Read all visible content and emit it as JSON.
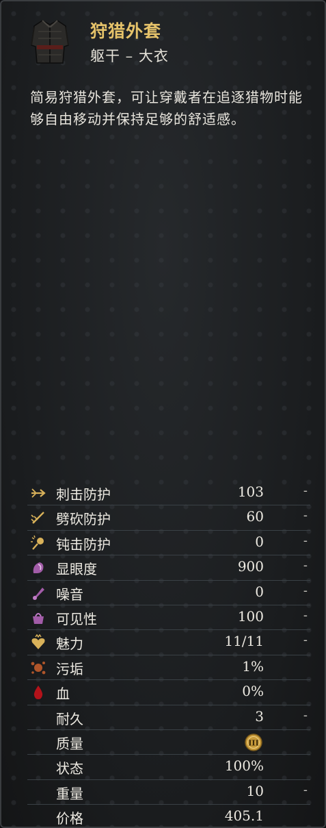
{
  "item": {
    "title": "狩猎外套",
    "subtitle": "躯干 – 大衣",
    "description": "简易狩猎外套，可让穿戴者在追逐猎物时能够自由移动并保持足够的舒适感。",
    "icon": "hunting-coat-icon"
  },
  "stats": [
    {
      "name": "stab-protection",
      "icon": "stab-icon",
      "label": "刺击防护",
      "value": "103",
      "dash": "-"
    },
    {
      "name": "slash-protection",
      "icon": "slash-icon",
      "label": "劈砍防护",
      "value": "60",
      "dash": "-"
    },
    {
      "name": "blunt-protection",
      "icon": "blunt-icon",
      "label": "钝击防护",
      "value": "0",
      "dash": "-"
    },
    {
      "name": "conspicuousness",
      "icon": "conspicuousness-icon",
      "label": "显眼度",
      "value": "900",
      "dash": "-"
    },
    {
      "name": "noise",
      "icon": "noise-icon",
      "label": "噪音",
      "value": "0",
      "dash": "-"
    },
    {
      "name": "visibility",
      "icon": "visibility-icon",
      "label": "可见性",
      "value": "100",
      "dash": "-"
    },
    {
      "name": "charisma",
      "icon": "charisma-icon",
      "label": "魅力",
      "value": "11/11",
      "dash": "-"
    },
    {
      "name": "dirt",
      "icon": "dirt-icon",
      "label": "污垢",
      "value": "1%",
      "dash": ""
    },
    {
      "name": "blood",
      "icon": "blood-icon",
      "label": "血",
      "value": "0%",
      "dash": ""
    },
    {
      "name": "durability",
      "icon": "",
      "label": "耐久",
      "value": "3",
      "dash": "-"
    },
    {
      "name": "quality",
      "icon": "",
      "label": "质量",
      "value": "",
      "dash": "",
      "quality_badge": "III"
    },
    {
      "name": "condition",
      "icon": "",
      "label": "状态",
      "value": "100%",
      "dash": ""
    },
    {
      "name": "weight",
      "icon": "",
      "label": "重量",
      "value": "10",
      "dash": "-"
    },
    {
      "name": "price",
      "icon": "",
      "label": "价格",
      "value": "405.1",
      "dash": ""
    }
  ],
  "colors": {
    "title": "#e6c36a",
    "text": "#eeebe3",
    "icon_gold": "#d9b25a",
    "icon_purple": "#a25ca8",
    "icon_rust": "#b0552a",
    "icon_blood": "#b3121a",
    "background": "#1c1e20"
  }
}
